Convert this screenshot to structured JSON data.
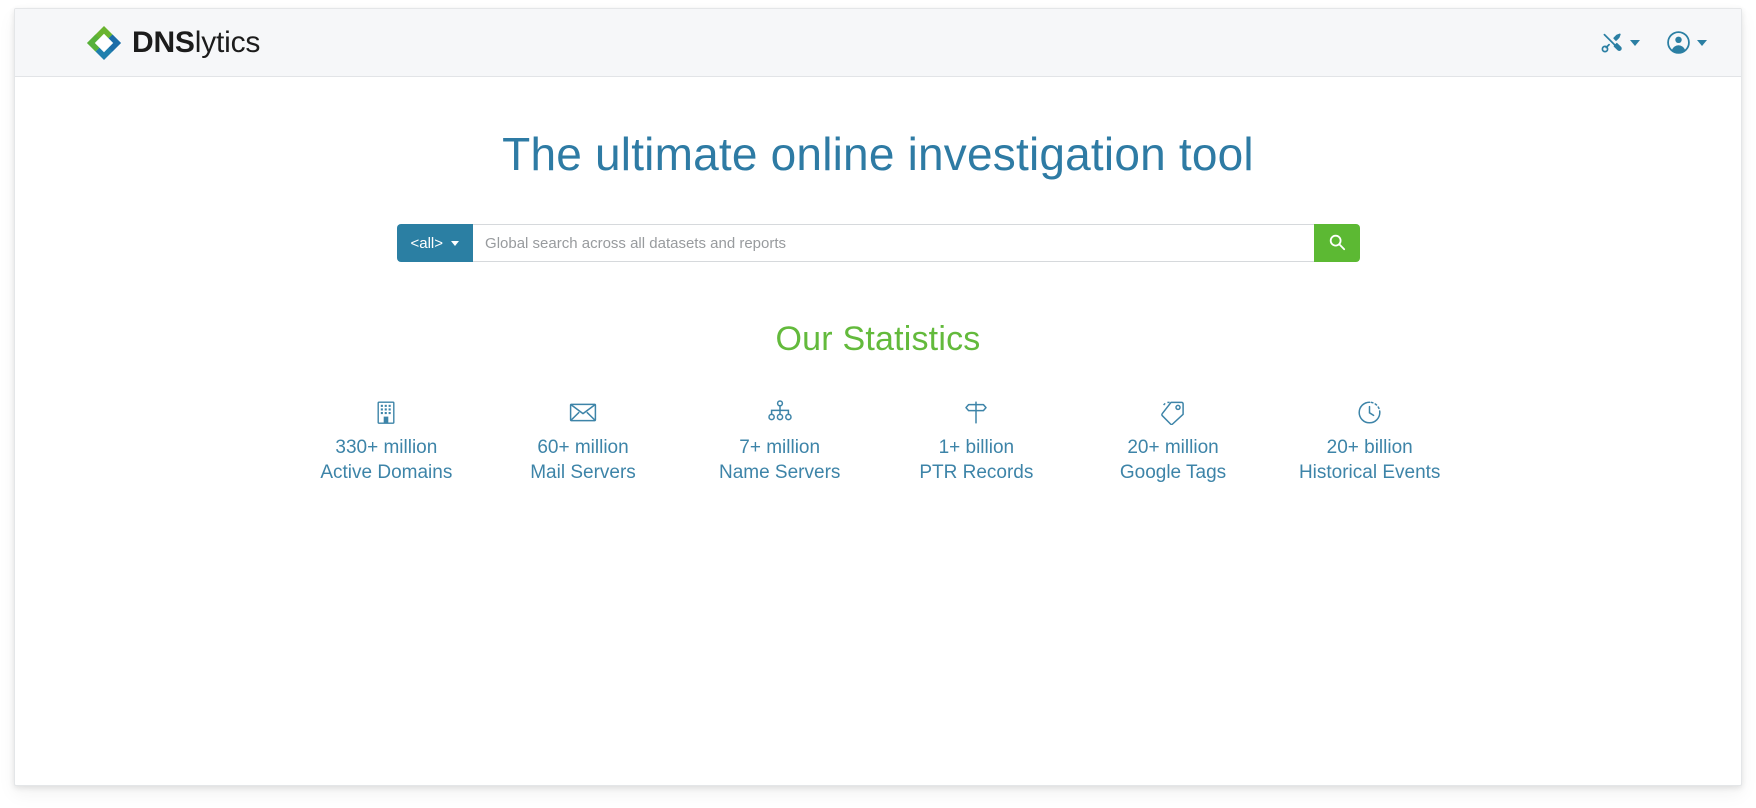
{
  "header": {
    "brand_bold": "DNS",
    "brand_light": "lytics",
    "logo_icon": "dnslytics-diamond-logo",
    "tools_icon": "tools-icon",
    "tools_caret_icon": "chevron-down-icon",
    "account_icon": "user-circle-icon",
    "account_caret_icon": "chevron-down-icon",
    "bg": "#f6f7f9"
  },
  "hero": {
    "title": "The ultimate online investigation tool",
    "title_color": "#2e7ba4"
  },
  "search": {
    "scope_label": "<all>",
    "scope_caret_icon": "chevron-down-icon",
    "placeholder": "Global search across all datasets and reports",
    "value": "",
    "button_icon": "search-icon",
    "scope_color": "#2b7fa3",
    "button_color": "#5cb933"
  },
  "statistics": {
    "title": "Our Statistics",
    "title_color": "#63ba3c",
    "items": [
      {
        "icon": "building-icon",
        "value": "330+ million",
        "label": "Active Domains"
      },
      {
        "icon": "envelope-icon",
        "value": "60+ million",
        "label": "Mail Servers"
      },
      {
        "icon": "sitemap-icon",
        "value": "7+ million",
        "label": "Name Servers"
      },
      {
        "icon": "signpost-icon",
        "value": "1+ billion",
        "label": "PTR Records"
      },
      {
        "icon": "tag-icon",
        "value": "20+ million",
        "label": "Google Tags"
      },
      {
        "icon": "clock-history-icon",
        "value": "20+ billion",
        "label": "Historical Events"
      }
    ]
  }
}
